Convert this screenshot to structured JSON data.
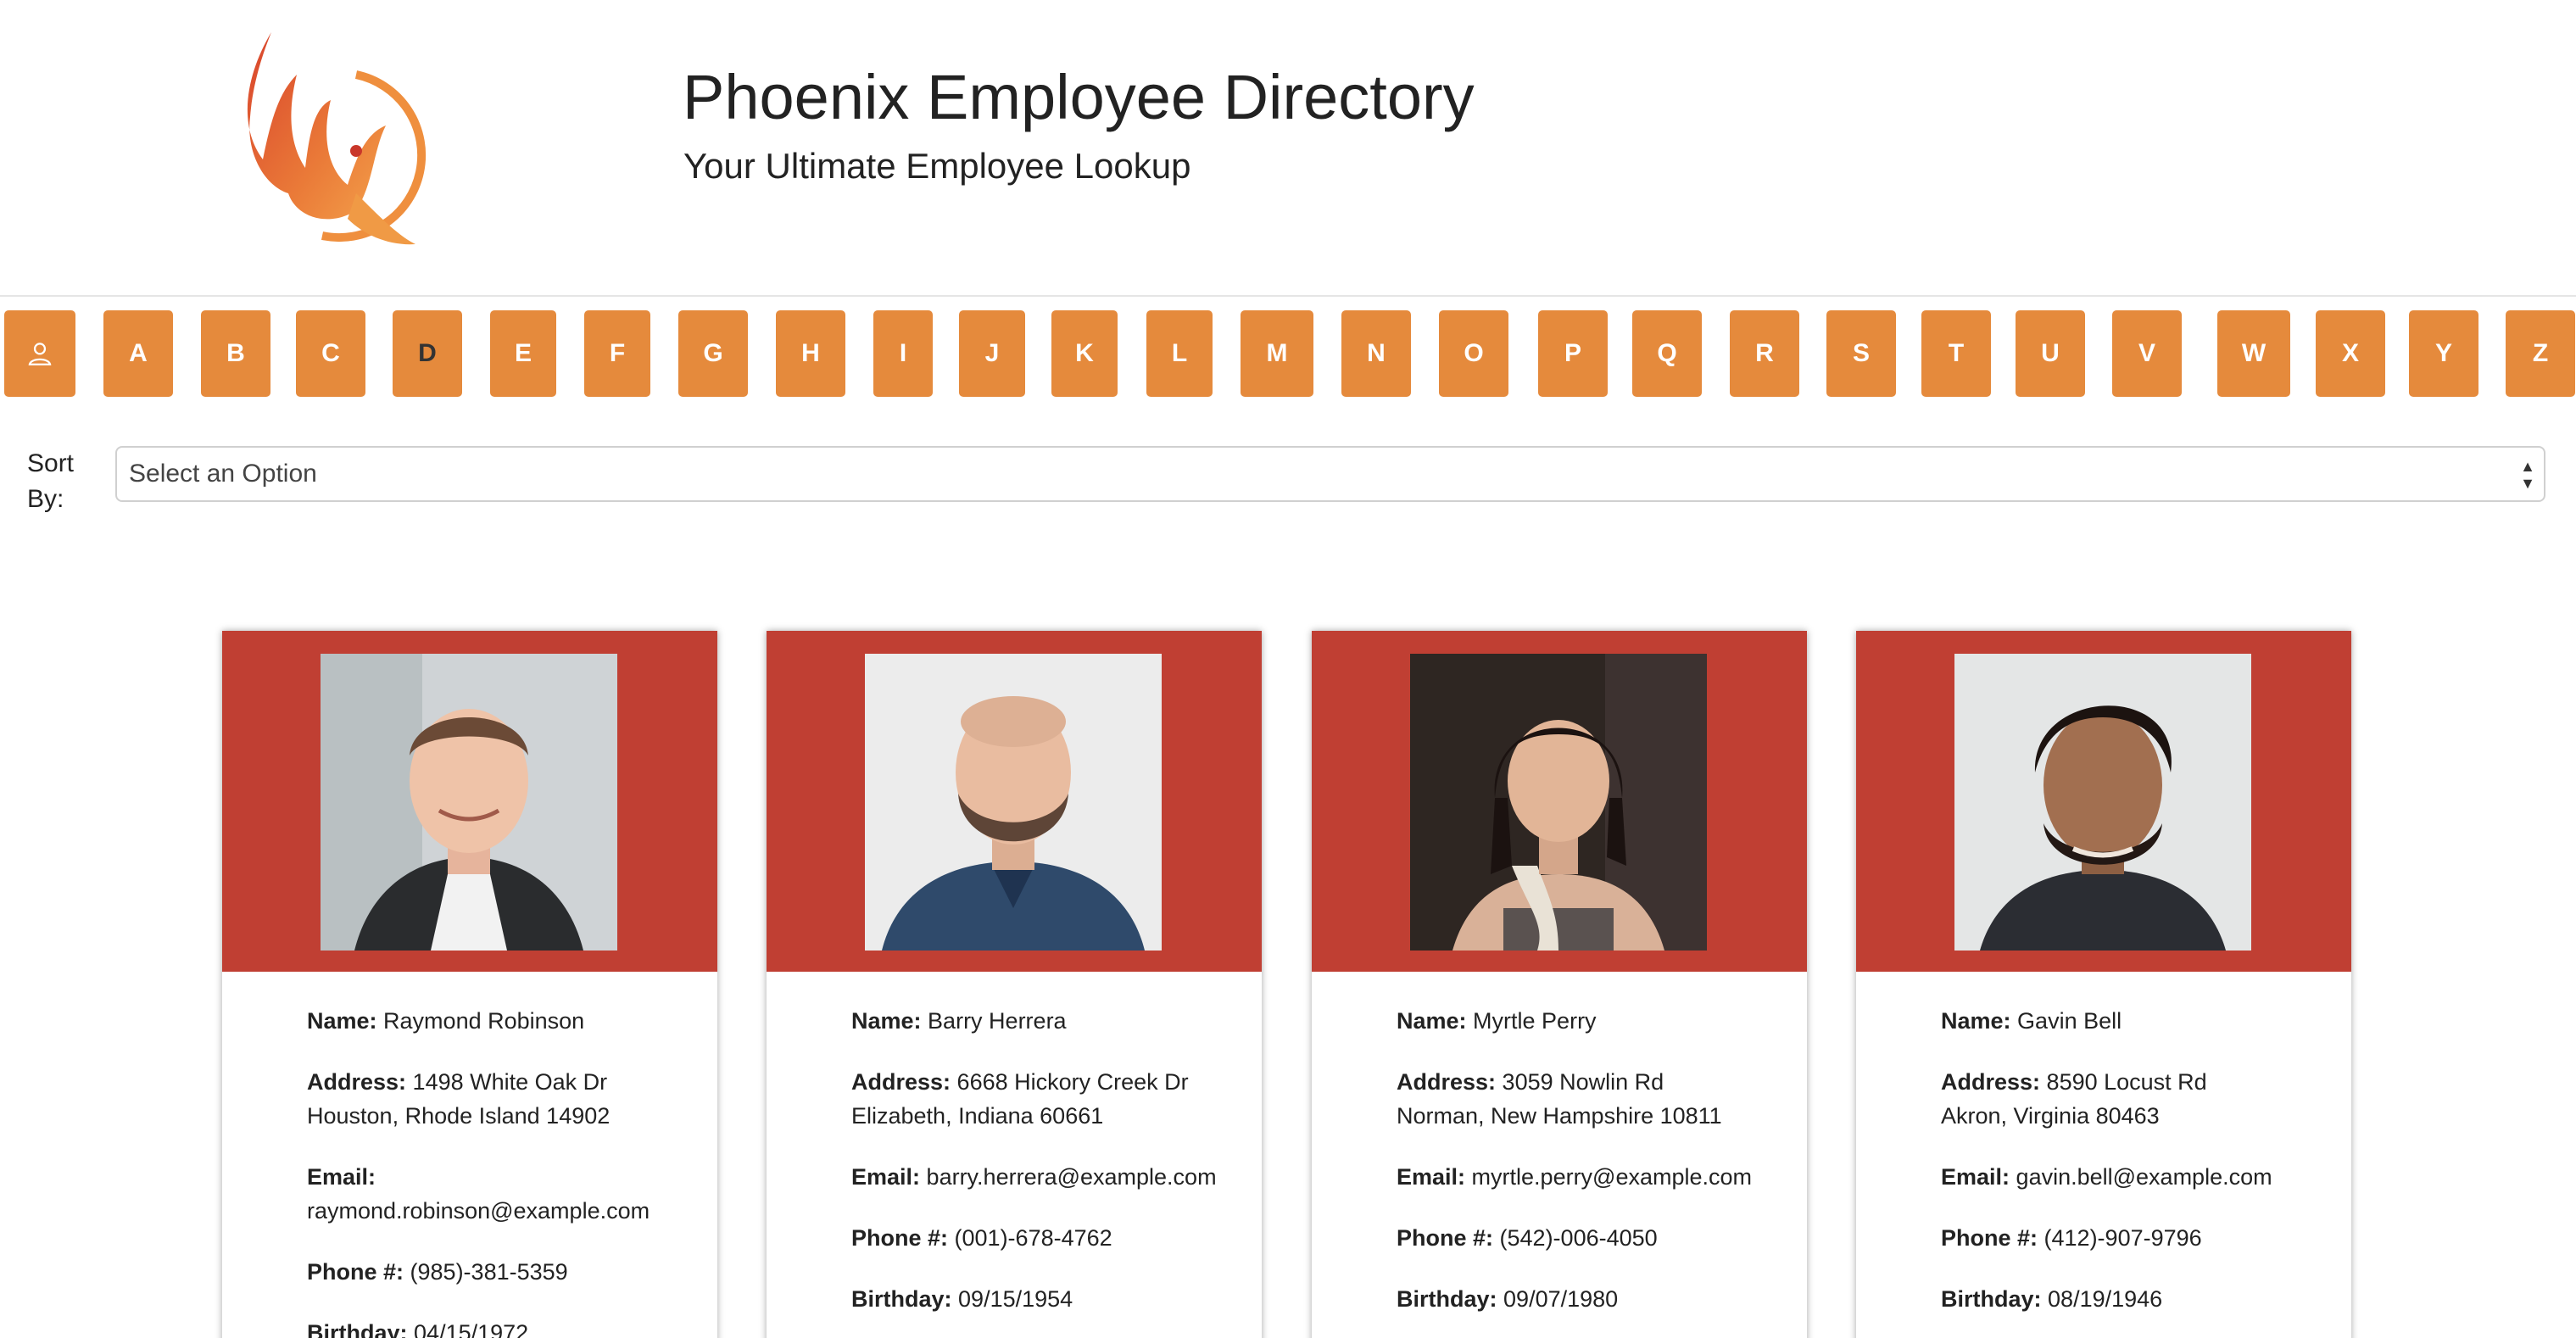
{
  "header": {
    "title": "Phoenix Employee Directory",
    "subtitle": "Your Ultimate Employee Lookup",
    "logo_icon": "phoenix-logo-icon"
  },
  "alphabet": {
    "icon": "person-icon",
    "letters": [
      "A",
      "B",
      "C",
      "D",
      "E",
      "F",
      "G",
      "H",
      "I",
      "J",
      "K",
      "L",
      "M",
      "N",
      "O",
      "P",
      "Q",
      "R",
      "S",
      "T",
      "U",
      "V",
      "W",
      "X",
      "Y",
      "Z"
    ],
    "active": "D",
    "button_color": "#e58a3c"
  },
  "sort": {
    "label": "Sort By:",
    "selected": "Select an Option"
  },
  "labels": {
    "name": "Name:",
    "address": "Address:",
    "email": "Email:",
    "phone": "Phone #:",
    "birthday": "Birthday:"
  },
  "card_color": "#c03f33",
  "employees": [
    {
      "name": "Raymond Robinson",
      "address_line1": "1498 White Oak Dr",
      "address_line2": "Houston, Rhode Island 14902",
      "email": "raymond.robinson@example.com",
      "phone": "(985)-381-5359",
      "birthday": "04/15/1972"
    },
    {
      "name": "Barry Herrera",
      "address_line1": "6668 Hickory Creek Dr",
      "address_line2": "Elizabeth, Indiana 60661",
      "email": "barry.herrera@example.com",
      "phone": "(001)-678-4762",
      "birthday": "09/15/1954"
    },
    {
      "name": "Myrtle Perry",
      "address_line1": "3059 Nowlin Rd",
      "address_line2": "Norman, New Hampshire 10811",
      "email": "myrtle.perry@example.com",
      "phone": "(542)-006-4050",
      "birthday": "09/07/1980"
    },
    {
      "name": "Gavin Bell",
      "address_line1": "8590 Locust Rd",
      "address_line2": "Akron, Virginia 80463",
      "email": "gavin.bell@example.com",
      "phone": "(412)-907-9796",
      "birthday": "08/19/1946"
    }
  ]
}
